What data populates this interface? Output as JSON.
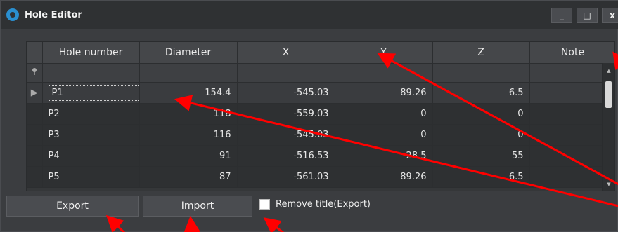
{
  "window": {
    "title": "Hole Editor",
    "controls": {
      "minimize": "_",
      "maximize": "□",
      "close": "x"
    }
  },
  "grid": {
    "columns": [
      "",
      "Hole number",
      "Diameter",
      "X",
      "Y",
      "Z",
      "Note"
    ],
    "filter_row_icon": "pin-icon",
    "rows": [
      {
        "hole": "P1",
        "diameter": "154.4",
        "x": "-545.03",
        "y": "89.26",
        "z": "6.5",
        "note": ""
      },
      {
        "hole": "P2",
        "diameter": "118",
        "x": "-559.03",
        "y": "0",
        "z": "0",
        "note": ""
      },
      {
        "hole": "P3",
        "diameter": "116",
        "x": "-545.03",
        "y": "0",
        "z": "0",
        "note": ""
      },
      {
        "hole": "P4",
        "diameter": "91",
        "x": "-516.53",
        "y": "-28.5",
        "z": "55",
        "note": ""
      },
      {
        "hole": "P5",
        "diameter": "87",
        "x": "-561.03",
        "y": "89.26",
        "z": "6.5",
        "note": ""
      }
    ],
    "selected_row": 0
  },
  "footer": {
    "export_label": "Export",
    "import_label": "Import",
    "remove_title_label": "Remove title(Export)",
    "remove_title_checked": false
  },
  "annotations": {
    "arrow_color": "#ff0000"
  }
}
